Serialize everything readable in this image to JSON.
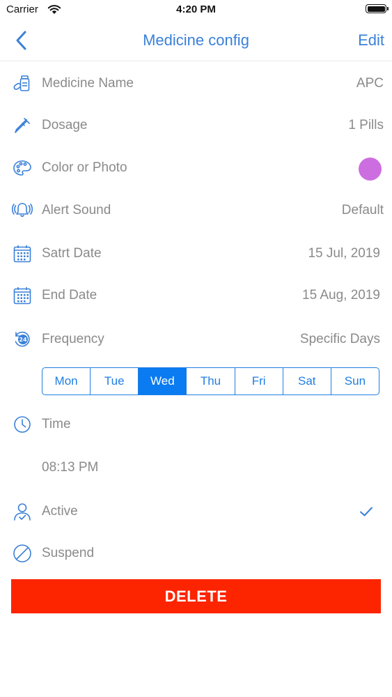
{
  "status_bar": {
    "carrier": "Carrier",
    "time": "4:20 PM"
  },
  "nav": {
    "title": "Medicine config",
    "edit_label": "Edit"
  },
  "fields": {
    "medicine_name": {
      "label": "Medicine Name",
      "value": "APC"
    },
    "dosage": {
      "label": "Dosage",
      "value": "1 Pills"
    },
    "color": {
      "label": "Color or Photo",
      "color": "#cc6ee0"
    },
    "alert_sound": {
      "label": "Alert Sound",
      "value": "Default"
    },
    "start_date": {
      "label": "Satrt Date",
      "value": "15 Jul, 2019"
    },
    "end_date": {
      "label": "End Date",
      "value": "15 Aug, 2019"
    },
    "frequency": {
      "label": "Frequency",
      "value": "Specific Days"
    },
    "time": {
      "label": "Time",
      "value": "08:13 PM"
    },
    "active": {
      "label": "Active",
      "checked": true
    },
    "suspend": {
      "label": "Suspend"
    }
  },
  "days": [
    {
      "label": "Mon",
      "selected": false
    },
    {
      "label": "Tue",
      "selected": false
    },
    {
      "label": "Wed",
      "selected": true
    },
    {
      "label": "Thu",
      "selected": false
    },
    {
      "label": "Fri",
      "selected": false
    },
    {
      "label": "Sat",
      "selected": false
    },
    {
      "label": "Sun",
      "selected": false
    }
  ],
  "delete_label": "DELETE",
  "colors": {
    "accent": "#3a80d8",
    "segment": "#1f7ee3",
    "selected_day": "#0a7bf0",
    "delete": "#fd2400",
    "text": "#8a8a8a"
  }
}
